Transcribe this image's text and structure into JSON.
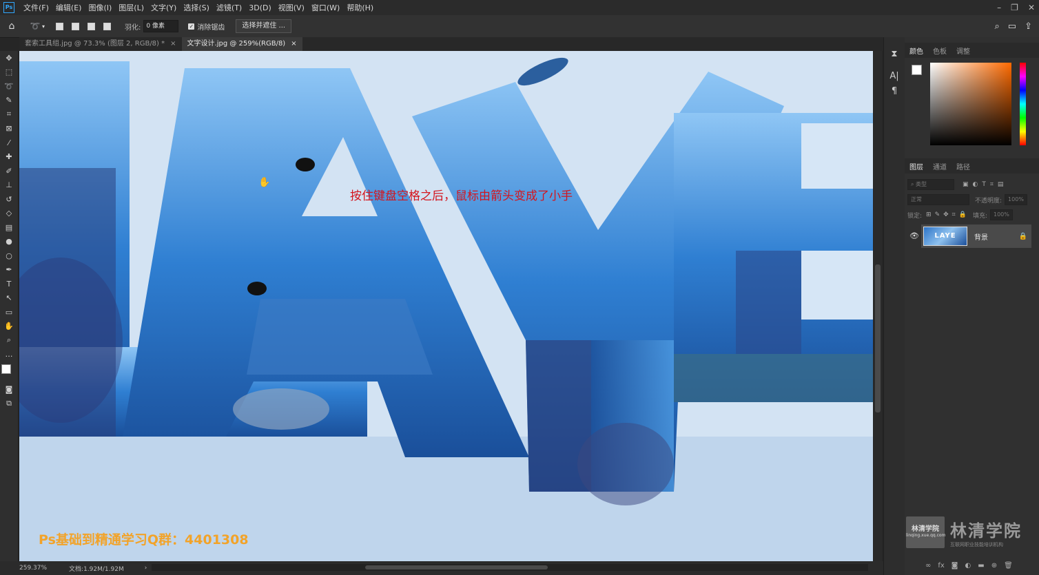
{
  "app": {
    "logo": "Ps"
  },
  "menu": [
    "文件(F)",
    "编辑(E)",
    "图像(I)",
    "图层(L)",
    "文字(Y)",
    "选择(S)",
    "滤镜(T)",
    "3D(D)",
    "视图(V)",
    "窗口(W)",
    "帮助(H)"
  ],
  "options": {
    "feather_label": "羽化:",
    "feather_value": "0 像素",
    "antialias_label": "消除锯齿",
    "select_mask_button": "选择并遮住 ..."
  },
  "tabs": [
    {
      "label": "套索工具组.jpg @ 73.3% (图层 2, RGB/8) *",
      "close": "×"
    },
    {
      "label": "文字设计.jpg @ 259%(RGB/8)",
      "close": "×"
    }
  ],
  "canvas": {
    "annotation": "按住键盘空格之后，鼠标由箭头变成了小手",
    "watermark_text": "Ps基础到精通学习Q群：4401308",
    "cursor_icon": "hand-cursor-icon"
  },
  "status": {
    "zoom": "259.37%",
    "doc": "文档:1.92M/1.92M",
    "arrow": "›"
  },
  "color_panel": {
    "tabs": [
      "颜色",
      "色板",
      "调整"
    ],
    "active": 0,
    "foreground": "#ffffff",
    "background": "#000000",
    "field_hue": "#ff6a00"
  },
  "layers_panel": {
    "tabs": [
      "图层",
      "通道",
      "路径"
    ],
    "active": 0,
    "filter_placeholder": "类型",
    "blend_mode": "正常",
    "opacity_label": "不透明度:",
    "opacity_value": "100%",
    "lock_label": "锁定:",
    "fill_label": "填充:",
    "fill_value": "100%",
    "layers": [
      {
        "name": "背景",
        "thumb_text": "LAYE",
        "visible": true,
        "locked": true
      }
    ]
  },
  "brand": {
    "box_title": "林清学院",
    "box_sub": "linqing.xue.qq.com",
    "title": "林清学院",
    "subtitle": "互联网职业技能培训机构"
  }
}
